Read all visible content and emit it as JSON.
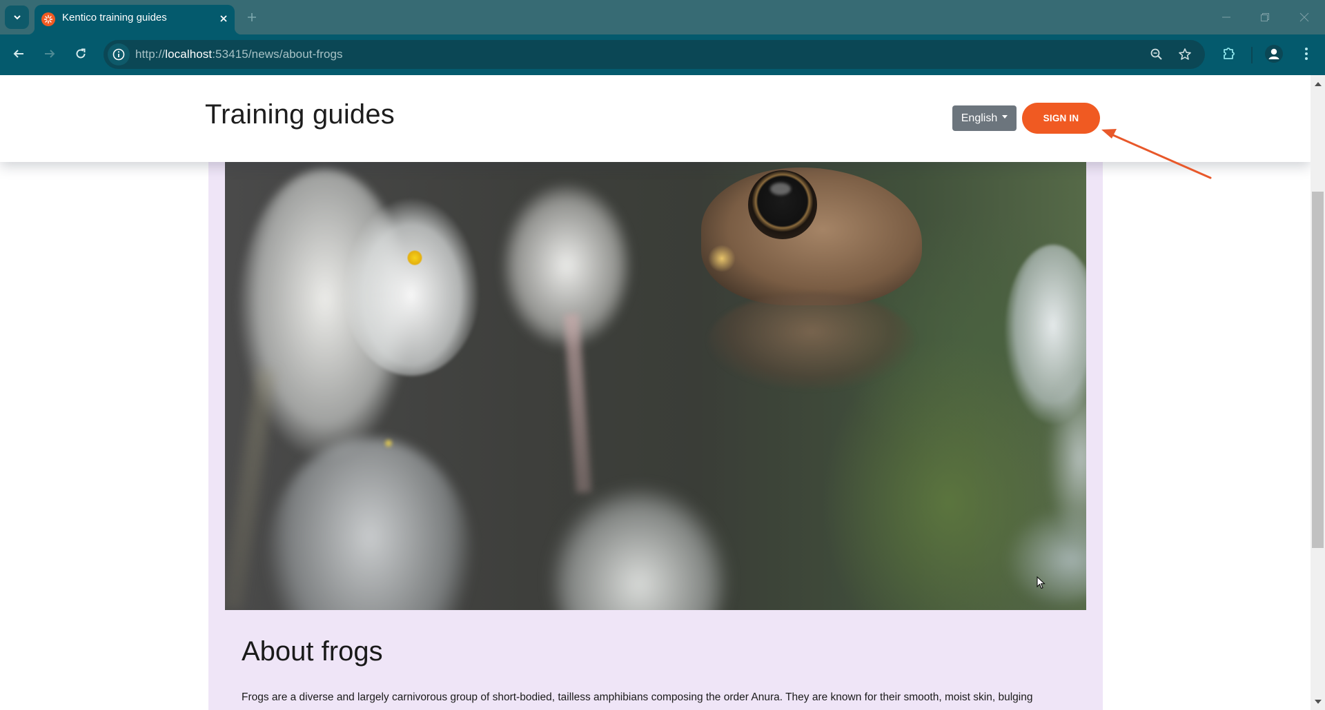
{
  "browser": {
    "tab": {
      "title": "Kentico training guides",
      "favicon": "kentico-logo-icon"
    },
    "new_tab_icon": "plus-icon",
    "address": {
      "scheme": "http://",
      "host": "localhost",
      "rest": ":53415/news/about-frogs"
    },
    "nav_icons": [
      "arrow-left-icon",
      "arrow-right-icon",
      "reload-icon"
    ],
    "omnibox_icons": [
      "zoom-out-icon",
      "star-icon"
    ],
    "toolbar_icons": [
      "extensions-icon",
      "profile-icon",
      "more-vert-icon"
    ],
    "window_controls": [
      "minimize-icon",
      "restore-icon",
      "close-icon"
    ]
  },
  "site": {
    "title": "Training guides",
    "language": {
      "selected": "English"
    },
    "sign_in_label": "SIGN IN",
    "accent_color": "#f05a22",
    "card_color": "#efe5f7"
  },
  "article": {
    "hero_image": "frog-among-white-flowers-in-pond",
    "title": "About frogs",
    "text": "Frogs are a diverse and largely carnivorous group of short-bodied, tailless amphibians composing the order Anura. They are known for their smooth, moist skin, bulging"
  },
  "annotation": {
    "type": "arrow",
    "points_to": "sign-in-button",
    "color": "#e8582a"
  }
}
